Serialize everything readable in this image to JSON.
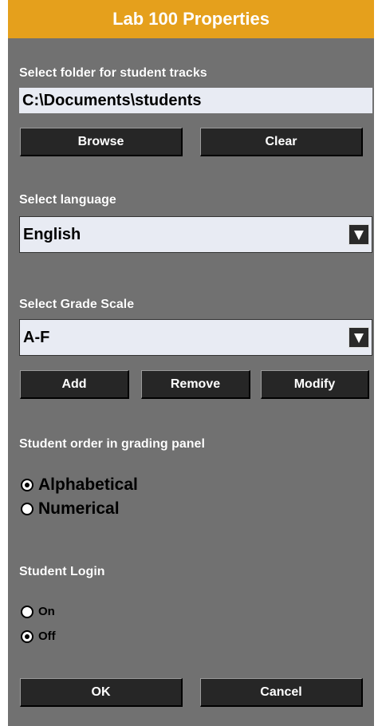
{
  "window": {
    "title": "Lab 100 Properties"
  },
  "folder": {
    "label": "Select folder for student tracks",
    "value": "C:\\Documents\\students",
    "browse_label": "Browse",
    "clear_label": "Clear"
  },
  "language": {
    "label": "Select language",
    "selected": "English"
  },
  "grade_scale": {
    "label": "Select Grade Scale",
    "selected": "A-F",
    "add_label": "Add",
    "remove_label": "Remove",
    "modify_label": "Modify"
  },
  "order": {
    "label": "Student order in grading panel",
    "options": [
      {
        "label": "Alphabetical",
        "checked": true
      },
      {
        "label": "Numerical",
        "checked": false
      }
    ]
  },
  "login": {
    "label": "Student Login",
    "options": [
      {
        "label": "On",
        "checked": false
      },
      {
        "label": "Off",
        "checked": true
      }
    ]
  },
  "footer": {
    "ok_label": "OK",
    "cancel_label": "Cancel"
  },
  "colors": {
    "titlebar": "#e5a01c",
    "panel": "#717171",
    "button": "#262626",
    "field": "#e8ebf3"
  }
}
